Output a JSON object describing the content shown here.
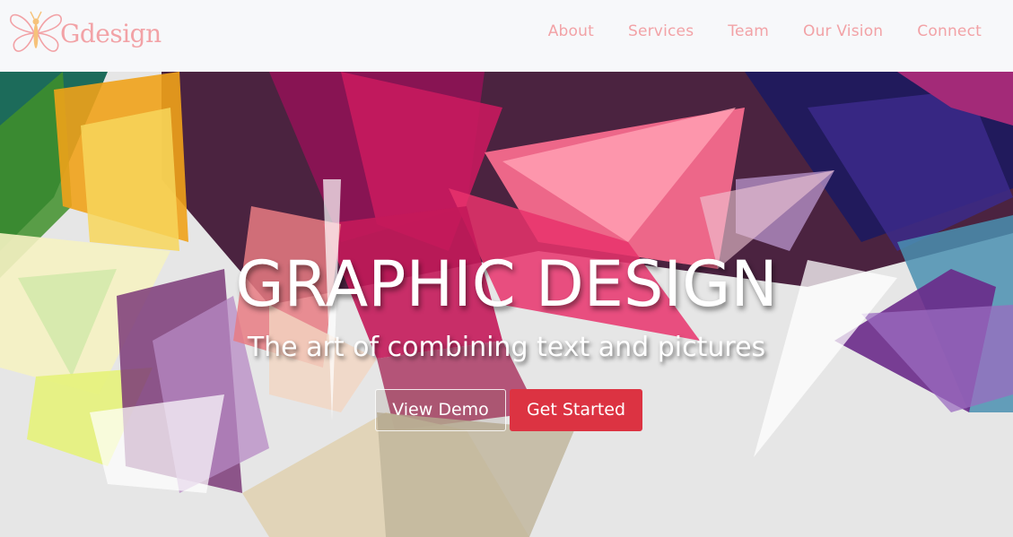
{
  "brand": {
    "name": "Gdesign",
    "logo_icon": "butterfly-icon"
  },
  "nav": {
    "items": [
      {
        "label": "About"
      },
      {
        "label": "Services"
      },
      {
        "label": "Team"
      },
      {
        "label": "Our Vision"
      },
      {
        "label": "Connect"
      }
    ]
  },
  "hero": {
    "title": "GRAPHIC DESIGN",
    "subtitle": "The art of combining text and pictures",
    "demo_button": "View Demo",
    "start_button": "Get Started"
  },
  "colors": {
    "brand_pink": "#f2a2a6",
    "accent_red": "#dc3342",
    "navbar_bg": "#f7f8fa"
  }
}
